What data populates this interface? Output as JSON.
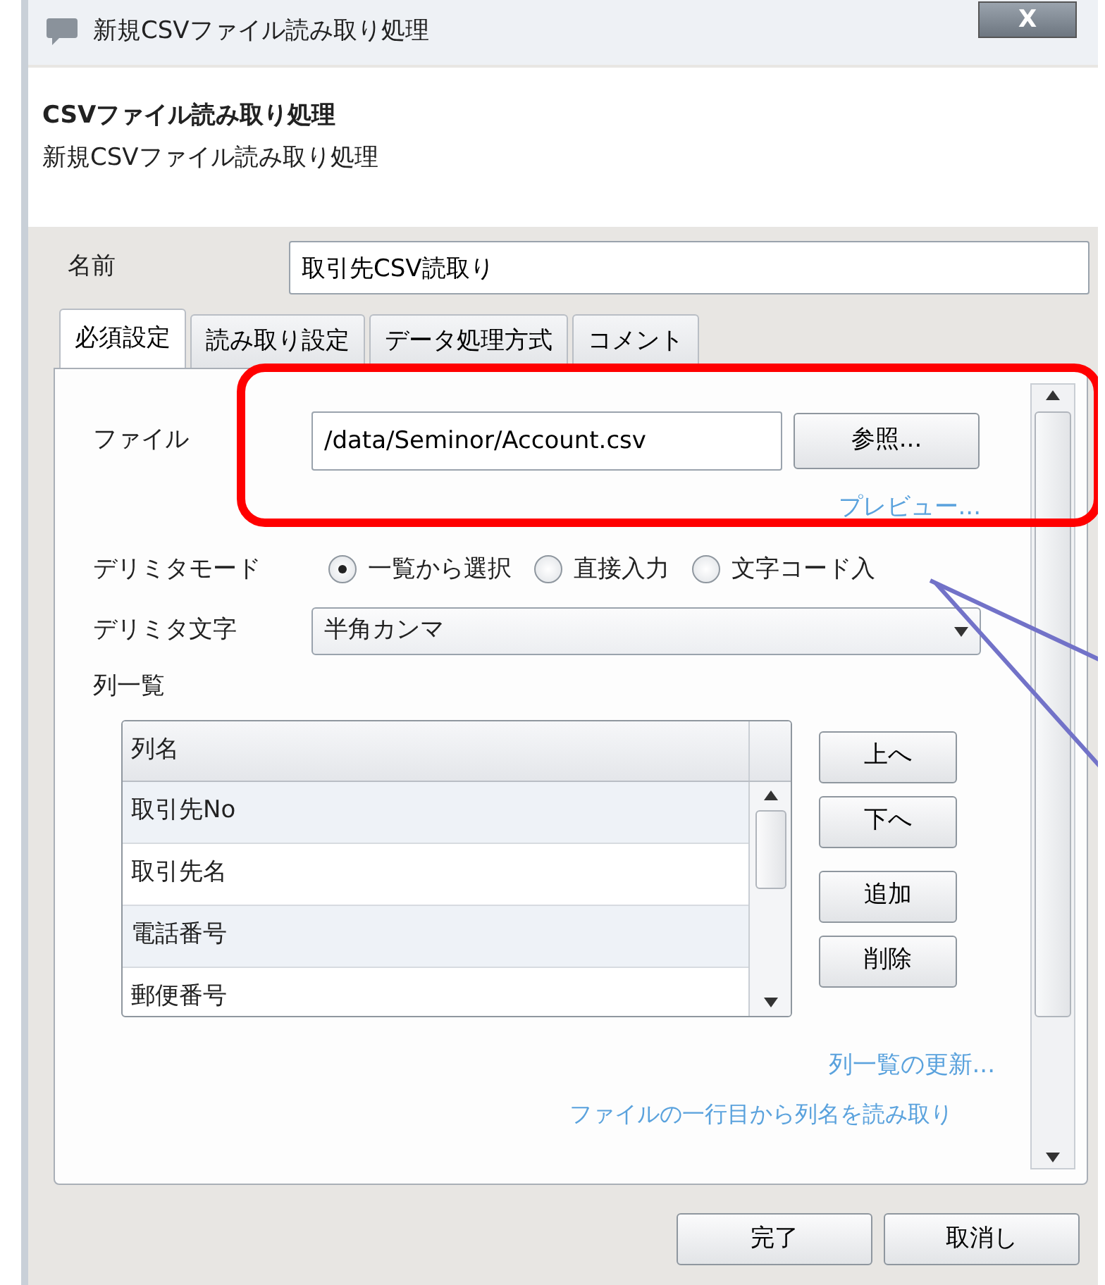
{
  "window": {
    "title": "新規CSVファイル読み取り処理",
    "close": "X"
  },
  "header": {
    "title": "CSVファイル読み取り処理",
    "subtitle": "新規CSVファイル読み取り処理"
  },
  "name_field": {
    "label": "名前",
    "value": "取引先CSV読取り"
  },
  "tabs": [
    {
      "label": "必須設定",
      "selected": true
    },
    {
      "label": "読み取り設定",
      "selected": false
    },
    {
      "label": "データ処理方式",
      "selected": false
    },
    {
      "label": "コメント",
      "selected": false
    }
  ],
  "file": {
    "label": "ファイル",
    "value": "/data/Seminor/Account.csv",
    "browse": "参照..."
  },
  "preview_link": "プレビュー...",
  "delimiter_mode": {
    "label": "デリミタモード",
    "options": [
      {
        "label": "一覧から選択",
        "selected": true
      },
      {
        "label": "直接入力",
        "selected": false
      },
      {
        "label": "文字コード入",
        "selected": false
      }
    ]
  },
  "delimiter_char": {
    "label": "デリミタ文字",
    "value": "半角カンマ"
  },
  "column_list": {
    "label": "列一覧",
    "header": "列名",
    "rows": [
      "取引先No",
      "取引先名",
      "電話番号",
      "郵便番号"
    ],
    "buttons": [
      "上へ",
      "下へ",
      "追加",
      "削除"
    ]
  },
  "refresh_link": "列一覧の更新...",
  "first_row_link": "ファイルの一行目から列名を読み取り",
  "buttons": [
    "完了",
    "取消し"
  ]
}
